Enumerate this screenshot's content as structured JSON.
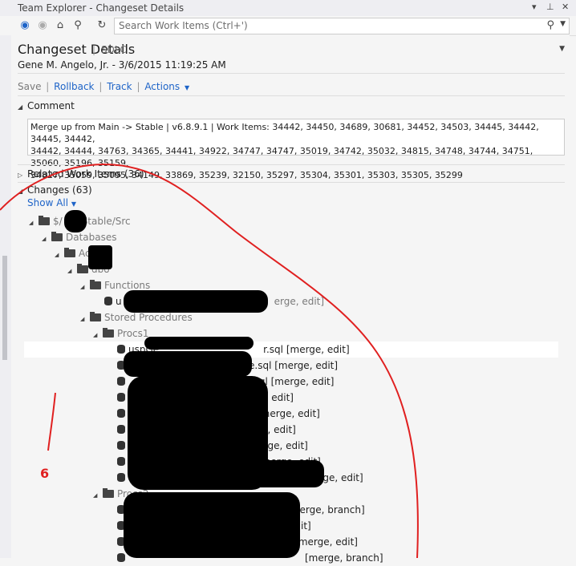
{
  "window": {
    "title": "Team Explorer - Changeset Details"
  },
  "search": {
    "placeholder": "Search Work Items (Ctrl+')"
  },
  "header": {
    "title": "Changeset Details",
    "project": "SDLC"
  },
  "author_line": "Gene M. Angelo, Jr. - 3/6/2015 11:19:25 AM",
  "actions": {
    "save": "Save",
    "rollback": "Rollback",
    "track": "Track",
    "actions": "Actions"
  },
  "comment": {
    "label": "Comment",
    "line1": "Merge up from Main -> Stable | v6.8.9.1 | Work Items: 34442, 34450, 34689, 30681, 34452, 34503, 34445, 34442, 34445, 34442,",
    "line2": "34442, 34444, 34763, 34365, 34441, 34922, 34747, 34747, 35019, 34742, 35032, 34815, 34748, 34744, 34751, 35060, 35196, 35159,",
    "line3": "34827, 35059, 35095, 34149, 33869, 35239, 32150, 35297, 35304, 35301, 35303, 35305, 35299"
  },
  "related": {
    "label": "Related Work Items (36)"
  },
  "changes": {
    "label": "Changes (63)",
    "show_all": "Show All"
  },
  "tree": {
    "root": "$/",
    "root_suffix": "Stable/Src",
    "databases": "Databases",
    "ac": "Ac",
    "dbo": "dbo",
    "functions": "Functions",
    "func_file_prefix": "u",
    "func_file_suffix": "erge, edit]",
    "stored_procedures": "Stored Procedures",
    "procs1": "Procs1",
    "procs2": "Procs2",
    "files1": [
      {
        "prefix": "uspGe",
        "suffix": "r.sql [merge, edit]"
      },
      {
        "prefix": "",
        "suffix": "e.sql [merge, edit]"
      },
      {
        "prefix": "",
        "suffix": "ID.sql [merge, edit]"
      },
      {
        "prefix": "",
        "suffix": "l [merge, edit]"
      },
      {
        "prefix": "",
        "suffix": "[merge, edit]"
      },
      {
        "prefix": "",
        "suffix": "[merge, edit]"
      },
      {
        "prefix": "",
        "suffix": "[merge, edit]"
      },
      {
        "prefix": "",
        "suffix": "sql [merge, edit]"
      },
      {
        "prefix": "us",
        "suffix": "[merge, edit]"
      }
    ],
    "files2": [
      {
        "prefix": "",
        "suffix": "l [merge, branch]"
      },
      {
        "prefix": "",
        "suffix": "edit]"
      },
      {
        "prefix": "",
        "suffix": "l [merge, edit]"
      },
      {
        "prefix": "",
        "suffix": "[merge, branch]"
      }
    ]
  },
  "annotation": {
    "text": "6"
  },
  "colors": {
    "link": "#1e64c8",
    "annotation": "#e02020"
  }
}
